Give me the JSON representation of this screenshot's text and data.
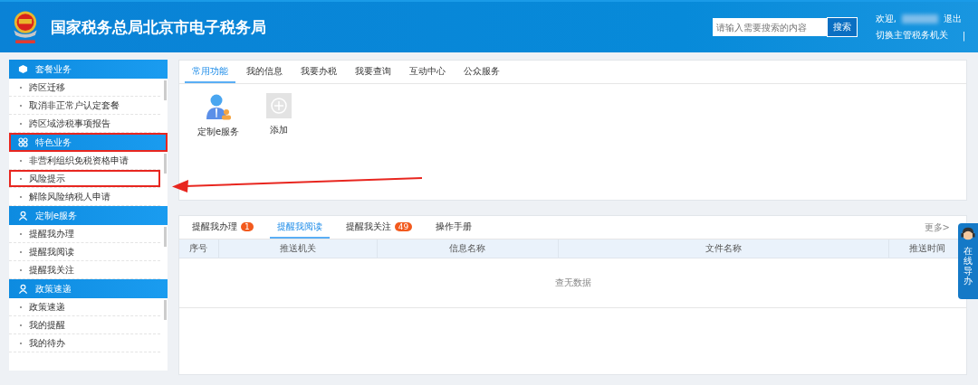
{
  "header": {
    "title": "国家税务总局北京市电子税务局",
    "search": {
      "placeholder": "请输入需要搜索的内容",
      "button": "搜索"
    },
    "welcome": "欢迎,",
    "logout": "退出",
    "switch_link": "切换主管税务机关",
    "separator": "|"
  },
  "sidebar": [
    {
      "title": "套餐业务",
      "highlighted": false,
      "items": [
        {
          "label": "跨区迁移",
          "highlighted": false
        },
        {
          "label": "取消非正常户认定套餐",
          "highlighted": false
        },
        {
          "label": "跨区域涉税事项报告",
          "highlighted": false
        }
      ]
    },
    {
      "title": "特色业务",
      "highlighted": true,
      "items": [
        {
          "label": "非营利组织免税资格申请",
          "highlighted": false
        },
        {
          "label": "风险提示",
          "highlighted": true
        },
        {
          "label": "解除风险纳税人申请",
          "highlighted": false
        }
      ]
    },
    {
      "title": "定制e服务",
      "highlighted": false,
      "items": [
        {
          "label": "提醒我办理",
          "highlighted": false
        },
        {
          "label": "提醒我阅读",
          "highlighted": false
        },
        {
          "label": "提醒我关注",
          "highlighted": false
        }
      ]
    },
    {
      "title": "政策速递",
      "highlighted": false,
      "items": [
        {
          "label": "政策速递",
          "highlighted": false
        },
        {
          "label": "我的提醒",
          "highlighted": false
        },
        {
          "label": "我的待办",
          "highlighted": false
        }
      ]
    }
  ],
  "top_tabs": [
    {
      "label": "常用功能",
      "selected": true
    },
    {
      "label": "我的信息",
      "selected": false
    },
    {
      "label": "我要办税",
      "selected": false
    },
    {
      "label": "我要查询",
      "selected": false
    },
    {
      "label": "互动中心",
      "selected": false
    },
    {
      "label": "公众服务",
      "selected": false
    }
  ],
  "shortcuts": [
    {
      "kind": "service",
      "label": "定制e服务"
    },
    {
      "kind": "add",
      "label": "添加"
    }
  ],
  "bottom_tabs": [
    {
      "label": "提醒我办理",
      "badge": "1",
      "selected": false
    },
    {
      "label": "提醒我阅读",
      "selected": true
    },
    {
      "label": "提醒我关注",
      "badge": "49",
      "selected": false
    },
    {
      "label": "操作手册",
      "selected": false
    }
  ],
  "more_link": "更多>",
  "table": {
    "columns": [
      "序号",
      "推送机关",
      "信息名称",
      "文件名称",
      "推送时间"
    ],
    "empty": "查无数据"
  },
  "online_guide": "在线导办"
}
